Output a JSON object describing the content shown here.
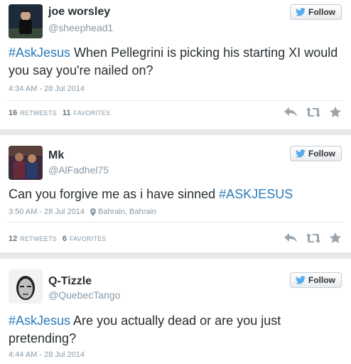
{
  "follow_label": "Follow",
  "colors": {
    "link": "#2b7bb9",
    "muted": "#8899a6",
    "text": "#292f33",
    "twitter_blue": "#55acee"
  },
  "icons": [
    "twitter-bird-icon",
    "reply-icon",
    "retweet-icon",
    "favorite-icon",
    "location-pin-icon"
  ],
  "tweets": [
    {
      "name": "joe worsley",
      "handle": "@sheephead1",
      "hashtag": "#AskJesus",
      "text": " When Pellegrini is picking his starting XI would you say you're nailed on?",
      "timestamp": "4:34 AM - 28 Jul 2014",
      "retweets_count": "16",
      "retweets_label": "RETWEETS",
      "favorites_count": "11",
      "favorites_label": "FAVORITES"
    },
    {
      "name": "Mk",
      "handle": "@AlFadhel75",
      "text": "Can you forgive me as i have sinned ",
      "hashtag": "#ASKJESUS",
      "timestamp": "3:50 AM - 28 Jul 2014",
      "location": "Bahrain, Bahrain",
      "retweets_count": "12",
      "retweets_label": "RETWEETS",
      "favorites_count": "6",
      "favorites_label": "FAVORITES"
    },
    {
      "name": "Q-Tizzle",
      "handle": "@QuebecTango",
      "hashtag": "#AskJesus",
      "text": " Are you actually dead or are you just pretending?",
      "timestamp": "4:44 AM - 28 Jul 2014"
    }
  ]
}
